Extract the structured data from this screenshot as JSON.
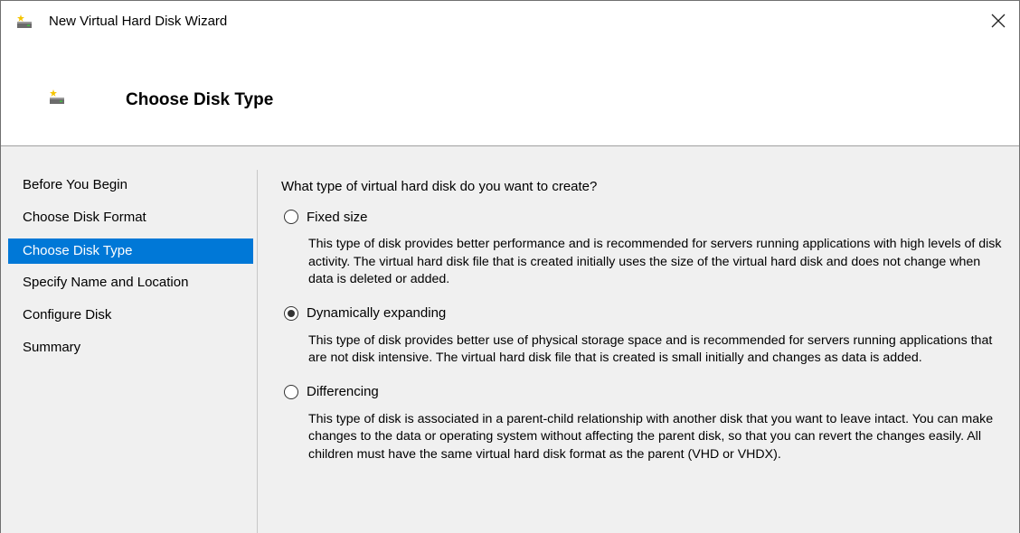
{
  "window": {
    "title": "New Virtual Hard Disk Wizard",
    "close_icon": "close-icon",
    "app_icon": "virtual-disk-icon"
  },
  "header": {
    "title": "Choose Disk Type",
    "icon": "virtual-disk-icon"
  },
  "nav": {
    "items": [
      {
        "label": "Before You Begin",
        "selected": false
      },
      {
        "label": "Choose Disk Format",
        "selected": false
      },
      {
        "label": "Choose Disk Type",
        "selected": true
      },
      {
        "label": "Specify Name and Location",
        "selected": false
      },
      {
        "label": "Configure Disk",
        "selected": false
      },
      {
        "label": "Summary",
        "selected": false
      }
    ]
  },
  "main": {
    "question": "What type of virtual hard disk do you want to create?",
    "options": [
      {
        "label": "Fixed size",
        "checked": false,
        "description": "This type of disk provides better performance and is recommended for servers running applications with high levels of disk activity. The virtual hard disk file that is created initially uses the size of the virtual hard disk and does not change when data is deleted or added."
      },
      {
        "label": "Dynamically expanding",
        "checked": true,
        "description": "This type of disk provides better use of physical storage space and is recommended for servers running applications that are not disk intensive. The virtual hard disk file that is created is small initially and changes as data is added."
      },
      {
        "label": "Differencing",
        "checked": false,
        "description": "This type of disk is associated in a parent-child relationship with another disk that you want to leave intact. You can make changes to the data or operating system without affecting the parent disk, so that you can revert the changes easily. All children must have the same virtual hard disk format as the parent (VHD or VHDX)."
      }
    ]
  },
  "colors": {
    "selection": "#0078d7",
    "panel_bg": "#f0f0f0"
  }
}
